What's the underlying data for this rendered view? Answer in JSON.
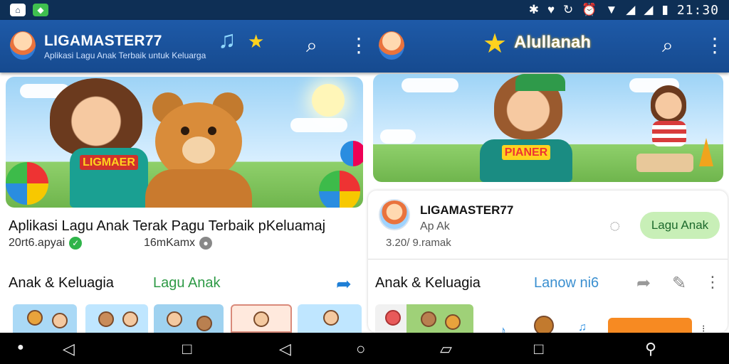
{
  "status_bar": {
    "time": "21:30"
  },
  "app_bar": {
    "title": "LIGAMASTER77",
    "subtitle": "Aplikasi Lagu Anak Terbaik untuk Keluarga",
    "right_title": "Alullanah",
    "icons": [
      "music-note-icon",
      "star-icon",
      "search-icon",
      "more-icon",
      "search-icon",
      "more-icon"
    ]
  },
  "left_content": {
    "item_title": "Aplikasi Lagu Anak Terak Pagu Terbaik pKeluamaj",
    "meta_left": "20rt6.apyai",
    "meta_right": "16mKamx",
    "section_title": "Anak & Keluagia",
    "section_tab": "Lagu Anak",
    "banner_shirt_text": "LIGMAER"
  },
  "right_content": {
    "banner_shirt_text": "PIANER",
    "channel_name": "LIGAMASTER77",
    "channel_sub": "Ap Ak",
    "channel_meta": "3.20/ 9.ramak",
    "channel_button": "Lagu Anak",
    "section_title": "Anak & Keluagia",
    "section_tab": "Lanow ni6"
  },
  "colors": {
    "status_bg": "#0e2f55",
    "app_bar_bg": "#1e5aa8",
    "accent_green": "#2e9a46",
    "pill_bg": "#c8efb7"
  }
}
